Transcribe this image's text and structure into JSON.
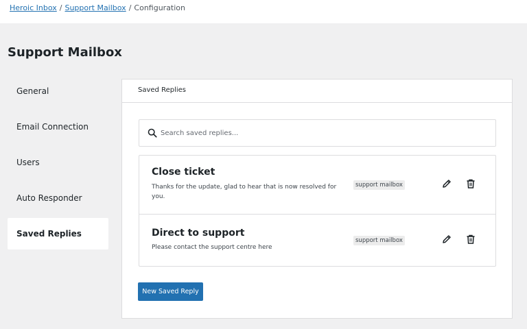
{
  "breadcrumb": {
    "items": [
      {
        "label": "Heroic Inbox"
      },
      {
        "label": "Support Mailbox"
      },
      {
        "label": "Configuration"
      }
    ],
    "separator": "/"
  },
  "page": {
    "title": "Support Mailbox"
  },
  "sidebar": {
    "items": [
      {
        "label": "General",
        "active": false
      },
      {
        "label": "Email Connection",
        "active": false
      },
      {
        "label": "Users",
        "active": false
      },
      {
        "label": "Auto Responder",
        "active": false
      },
      {
        "label": "Saved Replies",
        "active": true
      }
    ]
  },
  "panel": {
    "header": "Saved Replies",
    "search": {
      "placeholder": "Search saved replies...",
      "value": "",
      "icon": "search-icon"
    },
    "replies": [
      {
        "title": "Close ticket",
        "body": "Thanks for the update, glad to hear that is now resolved for you.",
        "tag": "support mailbox",
        "actions": [
          "pencil-icon",
          "trash-icon"
        ]
      },
      {
        "title": "Direct to support",
        "body": "Please contact the support centre here",
        "tag": "support mailbox",
        "actions": [
          "pencil-icon",
          "trash-icon"
        ]
      }
    ],
    "new_button": "New Saved Reply"
  },
  "colors": {
    "accent": "#2271b1",
    "page_background": "#f0f0f1",
    "card_background": "#ffffff",
    "border": "#dcdcde",
    "text": "#1d2327",
    "tag_background": "#ececec"
  }
}
